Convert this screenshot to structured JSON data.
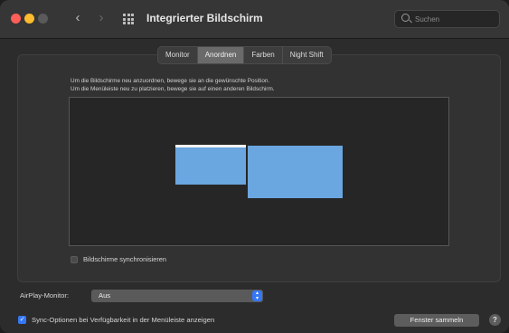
{
  "window": {
    "title": "Integrierter Bildschirm",
    "accent_color": "#3478f6"
  },
  "toolbar": {
    "back_glyph": "‹",
    "forward_glyph": "›",
    "grid_icon": "grid-icon"
  },
  "search": {
    "placeholder": "Suchen",
    "value": ""
  },
  "tabs": [
    {
      "label": "Monitor",
      "active": false
    },
    {
      "label": "Anordnen",
      "active": true
    },
    {
      "label": "Farben",
      "active": false
    },
    {
      "label": "Night Shift",
      "active": false
    }
  ],
  "arrange": {
    "instruction_line1": "Um die Bildschirme neu anzuordnen, bewege sie an die gewünschte Position.",
    "instruction_line2": "Um die Menüleiste neu zu platzieren, bewege sie auf einen anderen Bildschirm.",
    "mirror_label": "Bildschirme synchronisieren",
    "mirror_checked": false,
    "display_color": "#6aa6e0"
  },
  "airplay": {
    "label": "AirPlay-Monitor:",
    "value": "Aus"
  },
  "footer": {
    "sync_label": "Sync-Optionen bei Verfügbarkeit in der Menüleiste anzeigen",
    "sync_checked": true,
    "gather_button": "Fenster sammeln",
    "help_button": "?"
  }
}
